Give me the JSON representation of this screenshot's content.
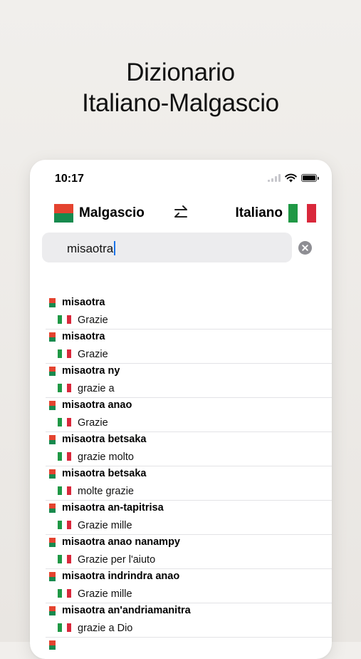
{
  "headline": {
    "line1": "Dizionario",
    "line2": "Italiano-Malgascio"
  },
  "status_bar": {
    "time": "10:17"
  },
  "language_bar": {
    "source_language": "Malgascio",
    "target_language": "Italiano",
    "source_flag": "madagascar-flag",
    "target_flag": "italy-flag",
    "swap_icon": "swap-arrows-icon"
  },
  "search": {
    "query": "misaotra",
    "clear_icon": "clear-circle-icon"
  },
  "results": [
    {
      "term": "misaotra",
      "translation": "Grazie"
    },
    {
      "term": "misaotra",
      "translation": "Grazie"
    },
    {
      "term": "misaotra ny",
      "translation": "grazie a"
    },
    {
      "term": "misaotra anao",
      "translation": "Grazie"
    },
    {
      "term": "misaotra betsaka",
      "translation": "grazie molto"
    },
    {
      "term": "misaotra betsaka",
      "translation": "molte grazie"
    },
    {
      "term": "misaotra an-tapitrisa",
      "translation": "Grazie mille"
    },
    {
      "term": "misaotra anao nanampy",
      "translation": "Grazie per l'aiuto"
    },
    {
      "term": "misaotra indrindra anao",
      "translation": "Grazie mille"
    },
    {
      "term": "misaotra an'andriamanitra",
      "translation": "grazie a Dio"
    }
  ],
  "colors": {
    "madagascar_red": "#e4432f",
    "madagascar_green": "#178a4e",
    "italy_green": "#1f9845",
    "italy_red": "#d9283b",
    "caret": "#1a73e8"
  }
}
